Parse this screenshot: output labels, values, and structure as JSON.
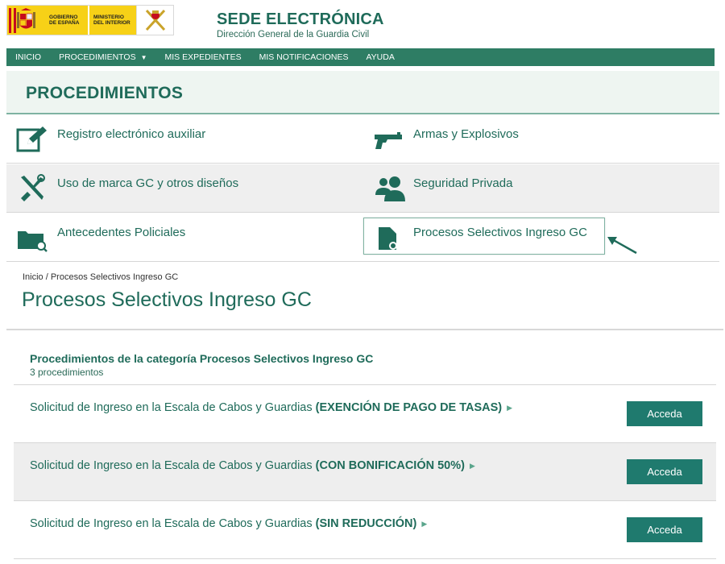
{
  "header": {
    "logo_gobierno": "GOBIERNO DE ESPAÑA",
    "logo_ministerio": "MINISTERIO DEL INTERIOR",
    "title": "SEDE ELECTRÓNICA",
    "subtitle": "Dirección General de la Guardia Civil"
  },
  "nav": {
    "items": [
      {
        "label": "INICIO"
      },
      {
        "label": "PROCEDIMIENTOS"
      },
      {
        "label": "MIS EXPEDIENTES"
      },
      {
        "label": "MIS NOTIFICACIONES"
      },
      {
        "label": "AYUDA"
      }
    ]
  },
  "categories": {
    "title": "PROCEDIMIENTOS",
    "items": [
      {
        "label": "Registro electrónico auxiliar",
        "icon": "edit-icon"
      },
      {
        "label": "Armas y Explosivos",
        "icon": "gun-icon"
      },
      {
        "label": "Uso de marca GC y otros diseños",
        "icon": "tools-icon"
      },
      {
        "label": "Seguridad Privada",
        "icon": "users-icon"
      },
      {
        "label": "Antecedentes Policiales",
        "icon": "folder-search-icon"
      },
      {
        "label": "Procesos Selectivos Ingreso GC",
        "icon": "certificate-icon"
      }
    ]
  },
  "breadcrumb": "Inicio / Procesos Selectivos Ingreso GC",
  "page_title": "Procesos Selectivos Ingreso GC",
  "list": {
    "heading": "Procedimientos de la categoría Procesos Selectivos Ingreso GC",
    "count": "3 procedimientos",
    "items": [
      {
        "prefix": "Solicitud de Ingreso en la Escala de Cabos y Guardias ",
        "bold": "(EXENCIÓN DE PAGO DE TASAS)",
        "button": "Acceda"
      },
      {
        "prefix": "Solicitud de Ingreso en la Escala de Cabos y Guardias ",
        "bold": "(CON BONIFICACIÓN 50%)",
        "button": "Acceda"
      },
      {
        "prefix": "Solicitud de Ingreso en la Escala de Cabos y Guardias ",
        "bold": "(SIN REDUCCIÓN)",
        "button": "Acceda"
      }
    ]
  },
  "colors": {
    "brand_green": "#1f6b5a",
    "nav_green": "#2e7d64",
    "button_green": "#1f7a6e"
  }
}
